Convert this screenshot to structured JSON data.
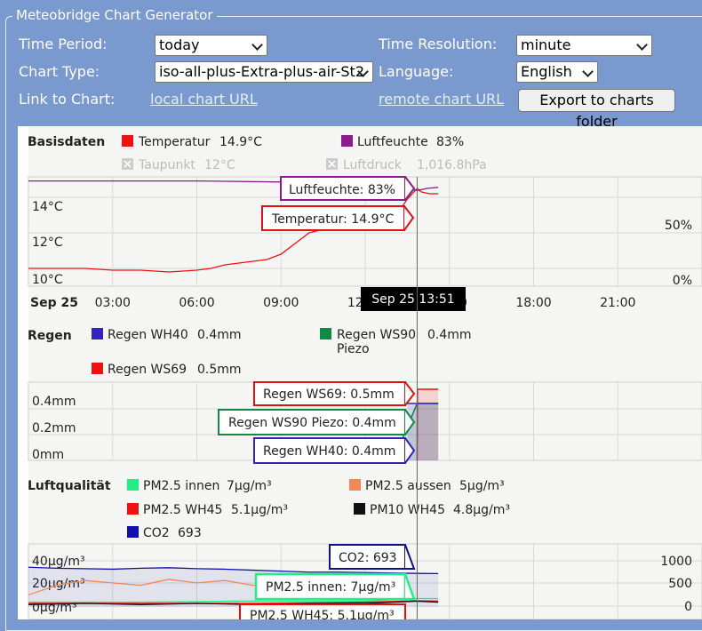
{
  "app": {
    "title": "Meteobridge Chart Generator"
  },
  "form": {
    "time_period_label": "Time Period:",
    "time_period_value": "today",
    "time_resolution_label": "Time Resolution:",
    "time_resolution_value": "minute",
    "chart_type_label": "Chart Type:",
    "chart_type_value": "iso-all-plus-Extra-plus-air-St2",
    "language_label": "Language:",
    "language_value": "English",
    "link_label": "Link to Chart:",
    "local_link": "local chart URL",
    "remote_link": "remote chart URL",
    "export_button": "Export to charts folder"
  },
  "panels": {
    "basis": {
      "title": "Basisdaten",
      "legend": [
        {
          "name": "Temperatur",
          "value": "14.9°C",
          "color": "#ee1111",
          "enabled": true
        },
        {
          "name": "Luftfeuchte",
          "value": "83%",
          "color": "#8b1c8b",
          "enabled": true
        },
        {
          "name": "Taupunkt",
          "value": "12°C",
          "color": "#cccccc",
          "enabled": false
        },
        {
          "name": "Luftdruck",
          "value": "1,016.8hPa",
          "color": "#cccccc",
          "enabled": false
        }
      ],
      "y_left_ticks": [
        "14°C",
        "12°C",
        "10°C"
      ],
      "y_right_ticks": [
        "50%",
        "0%"
      ],
      "tooltips": {
        "humidity": "Luftfeuchte: 83%",
        "temperature": "Temperatur: 14.9°C"
      }
    },
    "xaxis": {
      "date": "Sep 25",
      "ticks": [
        "03:00",
        "06:00",
        "09:00",
        "12:00",
        "15:00",
        "18:00",
        "21:00"
      ],
      "crosshair_label": "Sep 25 13:51"
    },
    "rain": {
      "title": "Regen",
      "legend": [
        {
          "name": "Regen WH40",
          "value": "0.4mm",
          "color": "#3322bb"
        },
        {
          "name": "Regen WS90 Piezo",
          "name_line1": "Regen WS90",
          "name_line2": "Piezo",
          "value": "0.4mm",
          "color": "#118844"
        },
        {
          "name": "Regen WS69",
          "value": "0.5mm",
          "color": "#ee1111"
        }
      ],
      "y_ticks": [
        "0.4mm",
        "0.2mm",
        "0mm"
      ],
      "tooltips": {
        "ws69": "Regen WS69: 0.5mm",
        "ws90": "Regen WS90 Piezo: 0.4mm",
        "wh40": "Regen WH40: 0.4mm"
      }
    },
    "air": {
      "title": "Luftqualität",
      "legend": [
        {
          "name": "PM2.5 innen",
          "value": "7µg/m³",
          "color": "#22ee88"
        },
        {
          "name": "PM2.5 aussen",
          "value": "5µg/m³",
          "color": "#f28855"
        },
        {
          "name": "PM2.5 WH45",
          "value": "5.1µg/m³",
          "color": "#ee1111"
        },
        {
          "name": "PM10 WH45",
          "value": "4.8µg/m³",
          "color": "#111111"
        },
        {
          "name": "CO2",
          "value": "693",
          "color": "#1111aa"
        }
      ],
      "y_left_ticks": [
        "40µg/m³",
        "20µg/m³",
        "0µg/m³"
      ],
      "y_right_ticks": [
        "1000",
        "500",
        "0"
      ],
      "tooltips": {
        "co2": "CO2: 693",
        "pm25_inner": "PM2.5 innen: 7µg/m³",
        "pm25_wh45": "PM2.5 WH45: 5.1µg/m³"
      }
    }
  },
  "chart_data": [
    {
      "type": "line",
      "title": "Basisdaten",
      "x_unit": "hour",
      "xlim": [
        0,
        24
      ],
      "series": [
        {
          "name": "Temperatur",
          "axis": "left",
          "color": "#ee1111",
          "x": [
            0,
            1,
            2,
            3,
            4,
            5,
            6,
            6.5,
            7,
            7.5,
            8,
            8.5,
            9,
            9.5,
            10,
            10.5,
            11,
            11.5,
            12,
            12.5,
            13,
            13.2,
            13.5,
            13.85,
            14,
            14.3,
            14.6
          ],
          "y": [
            10.6,
            10.6,
            10.6,
            10.5,
            10.5,
            10.4,
            10.5,
            10.6,
            10.8,
            10.9,
            11.0,
            11.1,
            11.4,
            12.0,
            12.6,
            12.8,
            12.9,
            12.9,
            12.9,
            13.0,
            13.4,
            13.8,
            14.5,
            15.1,
            14.9,
            14.8,
            14.8
          ]
        },
        {
          "name": "Luftfeuchte",
          "axis": "right",
          "color": "#8b1c8b",
          "x": [
            0,
            3,
            6,
            9,
            11,
            12,
            13,
            13.5,
            13.85,
            14.2,
            14.6
          ],
          "y": [
            92,
            92,
            92,
            91,
            91,
            91,
            89,
            85,
            83,
            85,
            86
          ]
        }
      ],
      "y_left_range": [
        10,
        15
      ],
      "y_right_range": [
        0,
        100
      ],
      "current": {
        "time": "Sep 25 13:51"
      }
    },
    {
      "type": "area",
      "title": "Regen",
      "x_unit": "hour",
      "xlim": [
        0,
        24
      ],
      "series": [
        {
          "name": "Regen WH40",
          "color": "#3322bb",
          "x": [
            13.5,
            13.85,
            14.6
          ],
          "y": [
            0.4,
            0.4,
            0.4
          ]
        },
        {
          "name": "Regen WS90 Piezo",
          "color": "#118844",
          "x": [
            13.0,
            13.85,
            14.6
          ],
          "y": [
            0.0,
            0.4,
            0.4
          ]
        },
        {
          "name": "Regen WS69",
          "color": "#ee1111",
          "x": [
            13.85,
            13.86,
            14.6
          ],
          "y": [
            0.0,
            0.5,
            0.5
          ]
        }
      ],
      "ylim": [
        0,
        0.5
      ]
    },
    {
      "type": "line",
      "title": "Luftqualität",
      "x_unit": "hour",
      "xlim": [
        0,
        24
      ],
      "series": [
        {
          "name": "CO2",
          "axis": "right",
          "color": "#1111aa",
          "x": [
            0,
            1,
            2,
            3,
            4,
            5,
            6,
            7,
            8,
            9,
            10,
            11,
            12,
            13,
            13.85,
            14.6
          ],
          "y": [
            820,
            800,
            790,
            780,
            800,
            810,
            790,
            780,
            760,
            740,
            720,
            720,
            710,
            700,
            693,
            690
          ]
        },
        {
          "name": "PM2.5 aussen",
          "axis": "left",
          "color": "#f28855",
          "x": [
            0,
            1,
            2,
            3,
            4,
            5,
            6,
            7,
            8,
            9,
            10,
            11,
            12,
            13,
            13.85
          ],
          "y": [
            10,
            18,
            22,
            20,
            18,
            23,
            20,
            22,
            18,
            20,
            19,
            16,
            12,
            10,
            5
          ]
        },
        {
          "name": "PM2.5 innen",
          "axis": "left",
          "color": "#22ee88",
          "x": [
            0,
            4,
            8,
            12,
            13.85,
            14.6
          ],
          "y": [
            4,
            4,
            5,
            5,
            7,
            7
          ]
        },
        {
          "name": "PM2.5 WH45",
          "axis": "left",
          "color": "#ee1111",
          "x": [
            0,
            4,
            8,
            12,
            13.85,
            14.6
          ],
          "y": [
            3,
            3,
            3,
            4,
            5.1,
            5
          ]
        },
        {
          "name": "PM10 WH45",
          "axis": "left",
          "color": "#111111",
          "x": [
            0,
            2,
            4,
            6,
            8,
            10,
            12,
            13.85,
            14.6
          ],
          "y": [
            2,
            3,
            2,
            3,
            2,
            3,
            3,
            4.8,
            4
          ]
        }
      ],
      "y_left_range": [
        0,
        45
      ],
      "y_right_range": [
        0,
        1100
      ]
    }
  ]
}
